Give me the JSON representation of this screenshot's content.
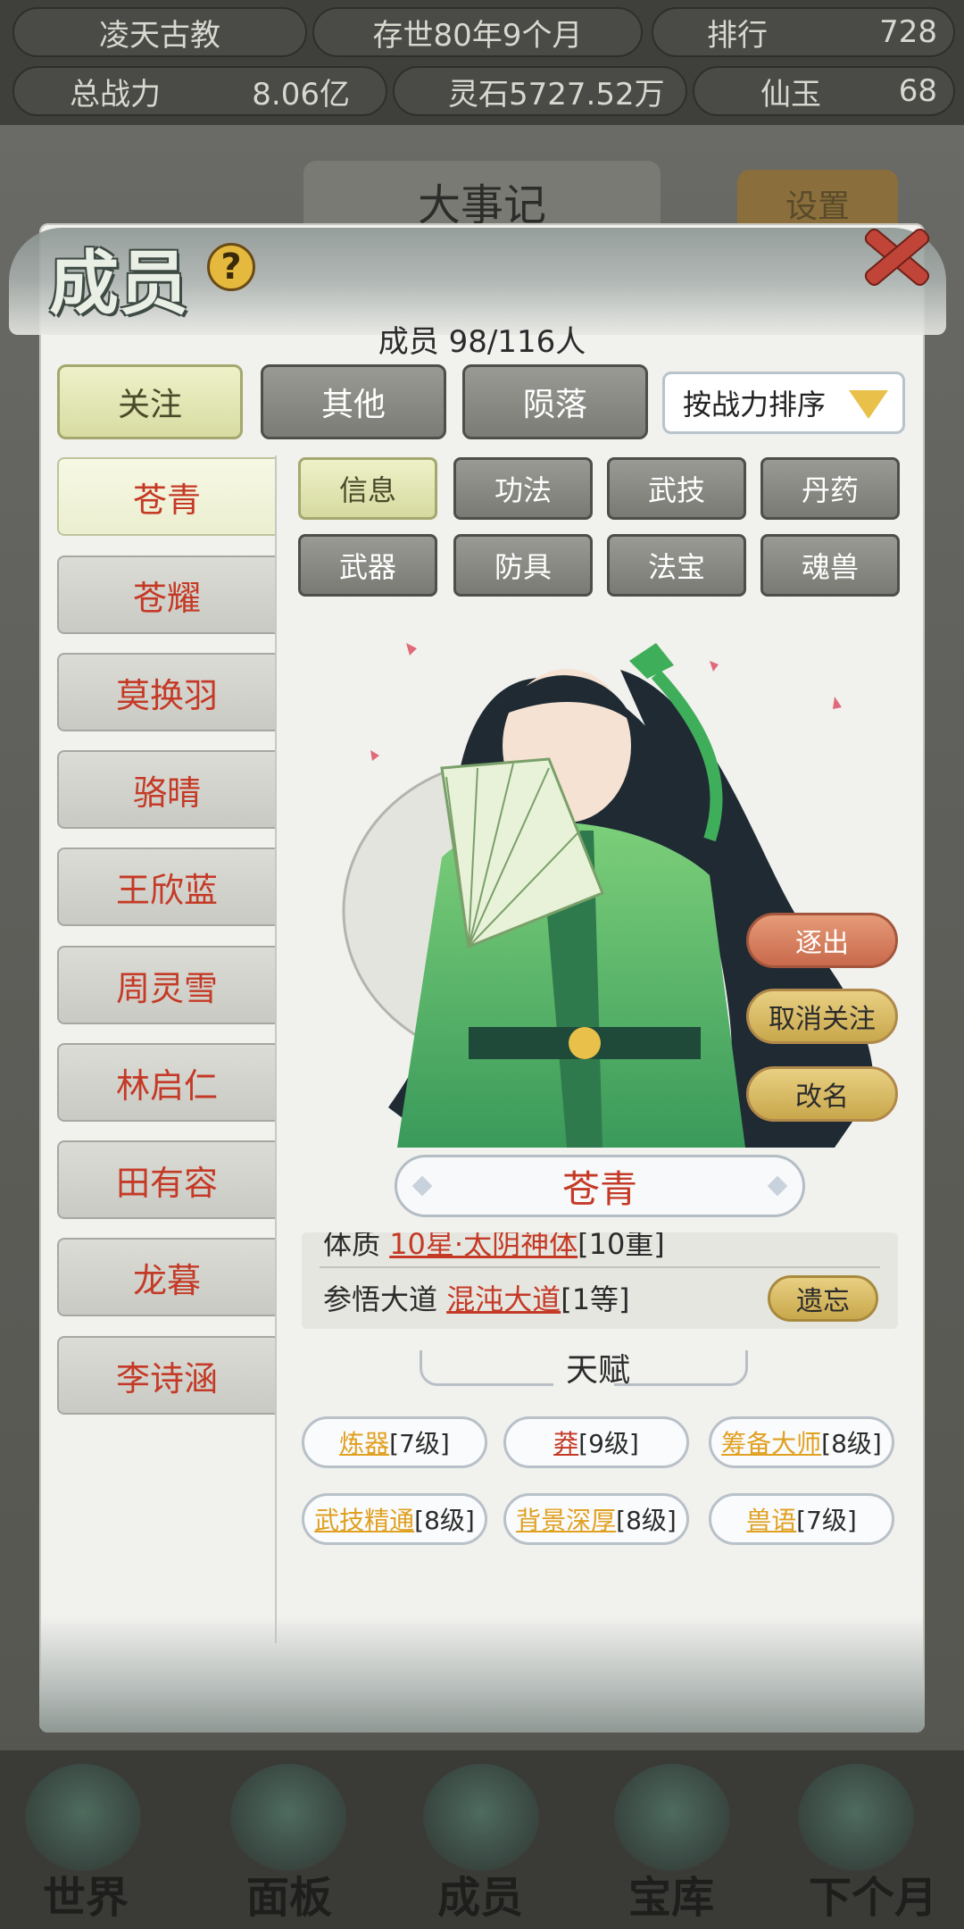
{
  "topbar": {
    "sect_name": "凌天古教",
    "existence": "存世80年9个月",
    "rank_label": "排行",
    "rank_value": "728",
    "power_label": "总战力",
    "power_value": "8.06亿",
    "spirit_stone": "灵石5727.52万",
    "jade_label": "仙玉",
    "jade_value": "68"
  },
  "background": {
    "event_title": "大事记",
    "settings_label": "设置"
  },
  "modal": {
    "title": "成员",
    "member_count": "成员  98/116人",
    "tabs": [
      {
        "label": "关注",
        "active": true
      },
      {
        "label": "其他",
        "active": false
      },
      {
        "label": "陨落",
        "active": false
      }
    ],
    "sort_label": "按战力排序",
    "members": [
      "苍青",
      "苍耀",
      "莫换羽",
      "骆晴",
      "王欣蓝",
      "周灵雪",
      "林启仁",
      "田有容",
      "龙暮",
      "李诗涵"
    ],
    "sub_tabs": [
      "信息",
      "功法",
      "武技",
      "丹药",
      "武器",
      "防具",
      "法宝",
      "魂兽"
    ],
    "actions": {
      "expel": "逐出",
      "unfollow": "取消关注",
      "rename": "改名"
    },
    "selected_name": "苍青",
    "info": {
      "physique_label": "体质",
      "physique_value": "10星·太阴神体",
      "physique_grade": "[10重]",
      "dao_label": "参悟大道",
      "dao_value": "混沌大道",
      "dao_grade": "[1等]",
      "forget_label": "遗忘"
    },
    "talent_title": "天赋",
    "talents": [
      {
        "name": "炼器",
        "level": "[7级]",
        "color": "gold"
      },
      {
        "name": "莽",
        "level": "[9级]",
        "color": "red"
      },
      {
        "name": "筹备大师",
        "level": "[8级]",
        "color": "gold"
      },
      {
        "name": "武技精通",
        "level": "[8级]",
        "color": "gold"
      },
      {
        "name": "背景深厚",
        "level": "[8级]",
        "color": "gold"
      },
      {
        "name": "兽语",
        "level": "[7级]",
        "color": "gold"
      }
    ]
  },
  "bottom_nav": [
    "世界",
    "面板",
    "成员",
    "宝库",
    "下个月"
  ],
  "colors": {
    "accent_red": "#c43a26",
    "talent_gold": "#e0a020",
    "active_tab": "#eef1c8"
  }
}
